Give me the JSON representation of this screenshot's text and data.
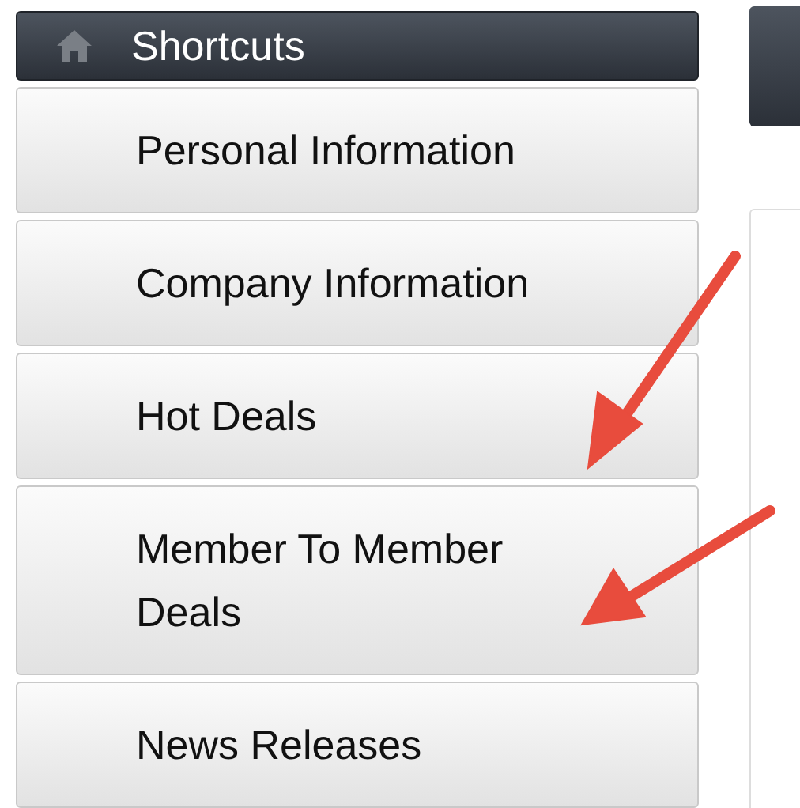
{
  "sidebar": {
    "title": "Shortcuts",
    "items": [
      {
        "label": "Personal Information"
      },
      {
        "label": "Company Information"
      },
      {
        "label": "Hot Deals"
      },
      {
        "label": "Member To Member Deals"
      },
      {
        "label": "News Releases"
      }
    ]
  }
}
